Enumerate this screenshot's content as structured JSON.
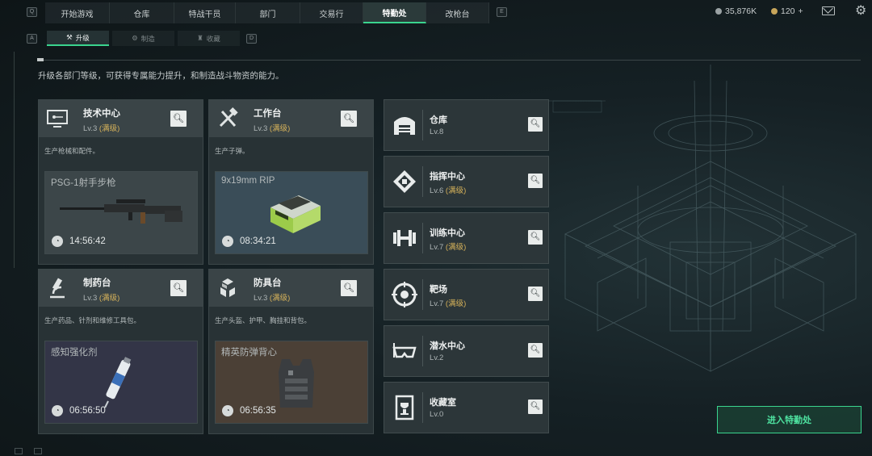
{
  "nav": {
    "left_key": "Q",
    "right_key": "E",
    "tabs": [
      {
        "label": "开始游戏"
      },
      {
        "label": "仓库"
      },
      {
        "label": "特战干员"
      },
      {
        "label": "部门"
      },
      {
        "label": "交易行"
      },
      {
        "label": "特勤处",
        "active": true
      },
      {
        "label": "改枪台"
      }
    ]
  },
  "resources": {
    "silver": "35,876K",
    "gold": "120",
    "gold_plus": "+"
  },
  "subnav": {
    "left_key": "A",
    "right_key": "D",
    "tabs": [
      {
        "label": "升级",
        "icon": "wrench-icon",
        "active": true
      },
      {
        "label": "制造",
        "icon": "gears-icon"
      },
      {
        "label": "收藏",
        "icon": "trophy-icon"
      }
    ]
  },
  "intro": "升级各部门等级，可获得专属能力提升，和制造战斗物资的能力。",
  "cards": [
    {
      "title": "技术中心",
      "level": "Lv.3",
      "max": "(满级)",
      "desc": "生产枪械和配件。",
      "product": "PSG-1射手步枪",
      "time": "14:56:42",
      "icon": "monitor-icon"
    },
    {
      "title": "工作台",
      "level": "Lv.3",
      "max": "(满级)",
      "desc": "生产子弹。",
      "product": "9x19mm RIP",
      "time": "08:34:21",
      "icon": "tools-icon"
    },
    {
      "title": "制药台",
      "level": "Lv.3",
      "max": "(满级)",
      "desc": "生产药品、针剂和维修工具包。",
      "product": "感知强化剂",
      "time": "06:56:50",
      "icon": "microscope-icon"
    },
    {
      "title": "防具台",
      "level": "Lv.3",
      "max": "(满级)",
      "desc": "生产头盔、护甲、胸挂和背包。",
      "product": "精英防弹背心",
      "time": "06:56:35",
      "icon": "armor-boxes-icon"
    }
  ],
  "facilities": [
    {
      "title": "仓库",
      "level": "Lv.8",
      "max": "",
      "icon": "warehouse-icon"
    },
    {
      "title": "指挥中心",
      "level": "Lv.6",
      "max": "(满级)",
      "icon": "chip-icon"
    },
    {
      "title": "训练中心",
      "level": "Lv.7",
      "max": "(满级)",
      "icon": "dumbbell-icon"
    },
    {
      "title": "靶场",
      "level": "Lv.7",
      "max": "(满级)",
      "icon": "target-icon"
    },
    {
      "title": "潜水中心",
      "level": "Lv.2",
      "max": "",
      "icon": "diving-mask-icon"
    },
    {
      "title": "收藏室",
      "level": "Lv.0",
      "max": "",
      "icon": "trophy-case-icon"
    }
  ],
  "enter_button": "进入特勤处",
  "colors": {
    "accent": "#3ad48e",
    "max_level": "#d6b25a"
  }
}
